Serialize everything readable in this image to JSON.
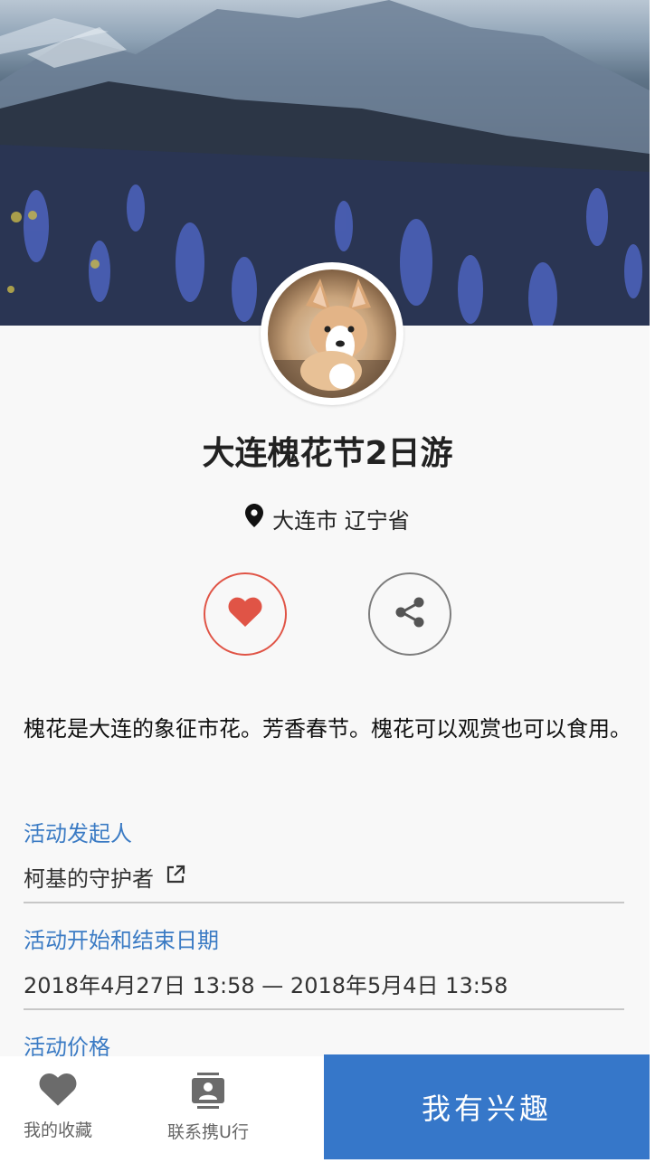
{
  "event": {
    "title": "大连槐花节2日游",
    "location": "大连市 辽宁省",
    "description": "槐花是大连的象征市花。芳香春节。槐花可以观赏也可以食用。"
  },
  "organizer": {
    "label": "活动发起人",
    "name": "柯基的守护者"
  },
  "dates": {
    "label": "活动开始和结束日期",
    "value": "2018年4月27日 13:58 — 2018年5月4日 13:58"
  },
  "price": {
    "label": "活动价格"
  },
  "actions": {
    "favorite_icon": "heart-icon",
    "share_icon": "share-icon"
  },
  "bottom_bar": {
    "favorites_label": "我的收藏",
    "contact_label": "联系携U行",
    "cta_label": "我有兴趣"
  },
  "colors": {
    "accent_blue": "#3677c9",
    "favorite_red": "#e05446",
    "label_blue": "#3b7bc4"
  }
}
